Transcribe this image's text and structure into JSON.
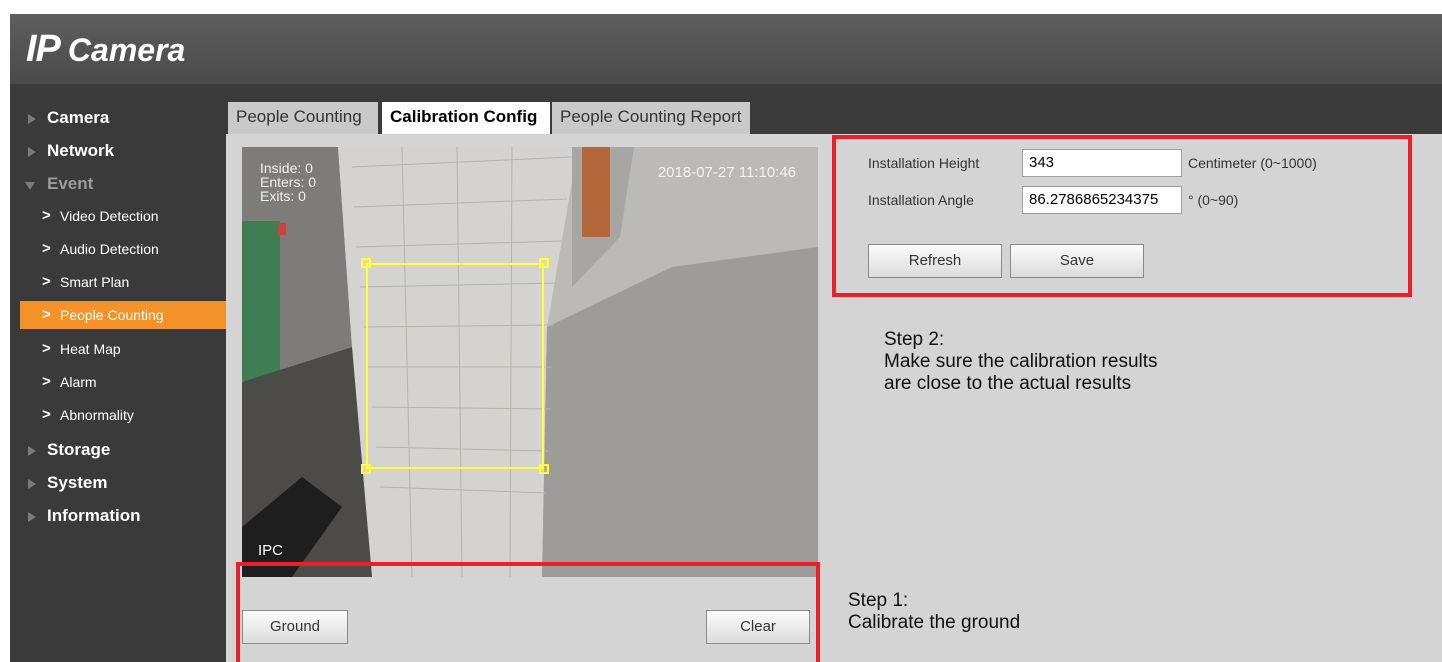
{
  "header": {
    "logo_ip": "IP",
    "logo_camera": "Camera"
  },
  "sidebar": {
    "items": [
      {
        "label": "Camera"
      },
      {
        "label": "Network"
      },
      {
        "label": "Event"
      },
      {
        "label": "Storage"
      },
      {
        "label": "System"
      },
      {
        "label": "Information"
      }
    ],
    "event_children": [
      {
        "label": "Video Detection"
      },
      {
        "label": "Audio Detection"
      },
      {
        "label": "Smart Plan"
      },
      {
        "label": "People Counting",
        "active": true
      },
      {
        "label": "Heat Map"
      },
      {
        "label": "Alarm"
      },
      {
        "label": "Abnormality"
      }
    ]
  },
  "tabs": [
    {
      "label": "People Counting"
    },
    {
      "label": "Calibration Config",
      "active": true
    },
    {
      "label": "People Counting Report"
    }
  ],
  "video": {
    "osd_inside": "Inside: 0",
    "osd_enters": "Enters: 0",
    "osd_exits": "Exits: 0",
    "timestamp": "2018-07-27 11:10:46",
    "channel_label": "IPC"
  },
  "calibration": {
    "installation_height_label": "Installation Height",
    "installation_height_value": "343",
    "installation_height_unit": "Centimeter (0~1000)",
    "installation_angle_label": "Installation Angle",
    "installation_angle_value": "86.2786865234375",
    "installation_angle_unit": "° (0~90)",
    "refresh_label": "Refresh",
    "save_label": "Save"
  },
  "ground_controls": {
    "ground_label": "Ground",
    "clear_label": "Clear"
  },
  "annotations": {
    "step2_title": "Step 2:",
    "step2_line1": "Make sure the calibration results",
    "step2_line2": "are close to the actual results",
    "step1_title": "Step 1:",
    "step1_line1": "Calibrate the ground"
  },
  "colors": {
    "accent": "#f4922a",
    "highlight_box": "#e8202a",
    "calib_rect": "#ffff33"
  }
}
